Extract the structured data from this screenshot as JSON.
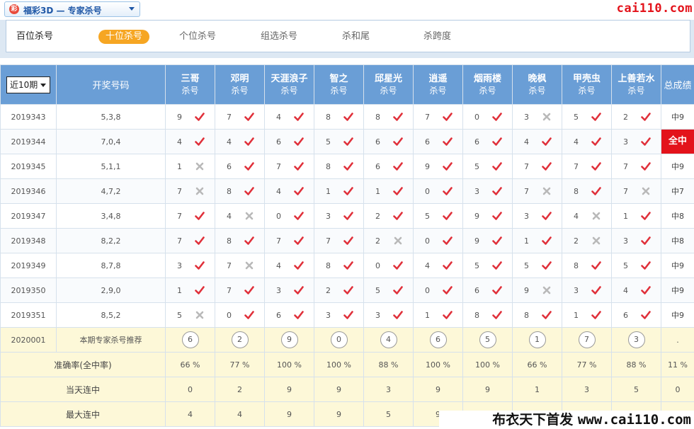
{
  "header": {
    "lottery_select": "福彩3D — 专家杀号",
    "logo_char": "彩",
    "site": "cai110.com"
  },
  "tabs": [
    {
      "label": "百位杀号",
      "state": "normal"
    },
    {
      "label": "十位杀号",
      "state": "active"
    },
    {
      "label": "个位杀号",
      "state": "normal"
    },
    {
      "label": "组选杀号",
      "state": "normal"
    },
    {
      "label": "杀和尾",
      "state": "normal"
    },
    {
      "label": "杀跨度",
      "state": "normal"
    }
  ],
  "table": {
    "period_select": "近10期",
    "draw_header": "开奖号码",
    "sub_label": "杀号",
    "total_header": "总成绩",
    "experts": [
      "三哥",
      "邓明",
      "天涯浪子",
      "智之",
      "邱星光",
      "逍遥",
      "烟雨楼",
      "晚枫",
      "甲壳虫",
      "上善若水"
    ],
    "rows": [
      {
        "period": "2019343",
        "draw": "5,3,8",
        "kills": [
          9,
          7,
          4,
          8,
          8,
          7,
          0,
          3,
          5,
          2
        ],
        "hits": [
          1,
          1,
          1,
          1,
          1,
          1,
          1,
          0,
          1,
          1
        ],
        "total": "中9",
        "full": false
      },
      {
        "period": "2019344",
        "draw": "7,0,4",
        "kills": [
          4,
          4,
          6,
          5,
          6,
          6,
          6,
          4,
          4,
          3
        ],
        "hits": [
          1,
          1,
          1,
          1,
          1,
          1,
          1,
          1,
          1,
          1
        ],
        "total": "全中",
        "full": true
      },
      {
        "period": "2019345",
        "draw": "5,1,1",
        "kills": [
          1,
          6,
          7,
          8,
          6,
          9,
          5,
          7,
          7,
          7
        ],
        "hits": [
          0,
          1,
          1,
          1,
          1,
          1,
          1,
          1,
          1,
          1
        ],
        "total": "中9",
        "full": false
      },
      {
        "period": "2019346",
        "draw": "4,7,2",
        "kills": [
          7,
          8,
          4,
          1,
          1,
          0,
          3,
          7,
          8,
          7
        ],
        "hits": [
          0,
          1,
          1,
          1,
          1,
          1,
          1,
          0,
          1,
          0
        ],
        "total": "中7",
        "full": false
      },
      {
        "period": "2019347",
        "draw": "3,4,8",
        "kills": [
          7,
          4,
          0,
          3,
          2,
          5,
          9,
          3,
          4,
          1
        ],
        "hits": [
          1,
          0,
          1,
          1,
          1,
          1,
          1,
          1,
          0,
          1
        ],
        "total": "中8",
        "full": false
      },
      {
        "period": "2019348",
        "draw": "8,2,2",
        "kills": [
          7,
          8,
          7,
          7,
          2,
          0,
          9,
          1,
          2,
          3
        ],
        "hits": [
          1,
          1,
          1,
          1,
          0,
          1,
          1,
          1,
          0,
          1
        ],
        "total": "中8",
        "full": false
      },
      {
        "period": "2019349",
        "draw": "8,7,8",
        "kills": [
          3,
          7,
          4,
          8,
          0,
          4,
          5,
          5,
          8,
          5
        ],
        "hits": [
          1,
          0,
          1,
          1,
          1,
          1,
          1,
          1,
          1,
          1
        ],
        "total": "中9",
        "full": false
      },
      {
        "period": "2019350",
        "draw": "2,9,0",
        "kills": [
          1,
          7,
          3,
          2,
          5,
          0,
          6,
          9,
          3,
          4
        ],
        "hits": [
          1,
          1,
          1,
          1,
          1,
          1,
          1,
          0,
          1,
          1
        ],
        "total": "中9",
        "full": false
      },
      {
        "period": "2019351",
        "draw": "8,5,2",
        "kills": [
          5,
          0,
          6,
          3,
          3,
          1,
          8,
          8,
          1,
          6
        ],
        "hits": [
          0,
          1,
          1,
          1,
          1,
          1,
          1,
          1,
          1,
          1
        ],
        "total": "中9",
        "full": false
      }
    ],
    "recommend": {
      "period": "2020001",
      "label": "本期专家杀号推荐",
      "values": [
        6,
        2,
        9,
        0,
        4,
        6,
        5,
        1,
        7,
        3
      ],
      "total": "."
    },
    "accuracy": {
      "label": "准确率(全中率)",
      "values": [
        "66 %",
        "77 %",
        "100 %",
        "100 %",
        "88 %",
        "100 %",
        "100 %",
        "66 %",
        "77 %",
        "88 %"
      ],
      "total": "11 %"
    },
    "current_streak": {
      "label": "当天连中",
      "values": [
        "0",
        "2",
        "9",
        "9",
        "3",
        "9",
        "9",
        "1",
        "3",
        "5"
      ],
      "total": "0"
    },
    "max_streak": {
      "label": "最大连中",
      "values": [
        "4",
        "4",
        "9",
        "9",
        "5",
        "9",
        "",
        "",
        "",
        ""
      ],
      "total": ""
    }
  },
  "watermark": {
    "prefix": "布衣天下首发 ",
    "site": "www.cai110.com"
  },
  "colors": {
    "header_blue": "#6a9ed6",
    "check_red": "#e0303a",
    "cross_gray": "#b9b9b9",
    "accent_orange": "#f6a623",
    "full_hit_red": "#e3131b",
    "summary_yellow": "#fdf8d8"
  },
  "icons": {
    "hit": "check-icon",
    "miss": "cross-icon"
  }
}
